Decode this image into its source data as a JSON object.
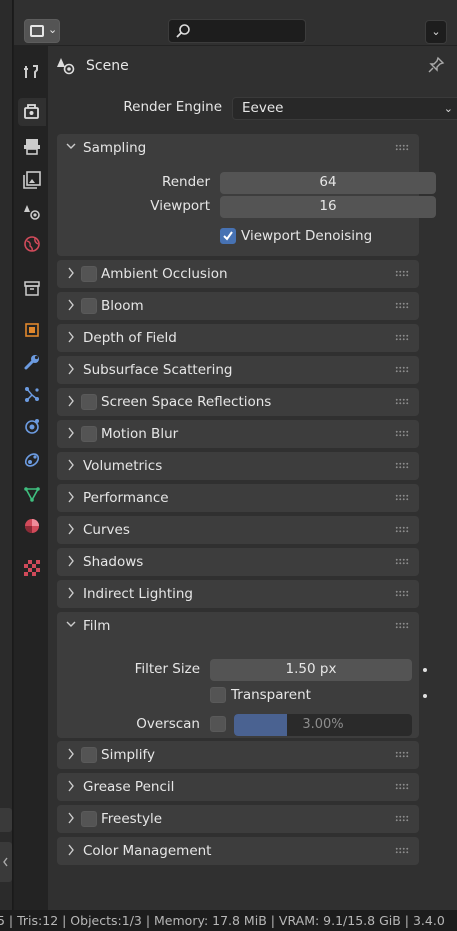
{
  "context": {
    "label": "Scene"
  },
  "render_engine": {
    "label": "Render Engine",
    "value": "Eevee"
  },
  "sampling": {
    "title": "Sampling",
    "render_label": "Render",
    "render_value": "64",
    "viewport_label": "Viewport",
    "viewport_value": "16",
    "denoise_label": "Viewport Denoising",
    "denoise_checked": true
  },
  "panels": {
    "ambient_occlusion": "Ambient Occlusion",
    "bloom": "Bloom",
    "depth_of_field": "Depth of Field",
    "subsurface_scattering": "Subsurface Scattering",
    "screen_space_reflections": "Screen Space Reflections",
    "motion_blur": "Motion Blur",
    "volumetrics": "Volumetrics",
    "performance": "Performance",
    "curves": "Curves",
    "shadows": "Shadows",
    "indirect_lighting": "Indirect Lighting",
    "film": "Film",
    "simplify": "Simplify",
    "grease_pencil": "Grease Pencil",
    "freestyle": "Freestyle",
    "color_management": "Color Management"
  },
  "film": {
    "filter_size_label": "Filter Size",
    "filter_size_value": "1.50 px",
    "transparent_label": "Transparent",
    "overscan_label": "Overscan",
    "overscan_value": "3.00%",
    "overscan_fraction": 0.3
  },
  "status_bar": {
    "text": "5 | Tris:12 | Objects:1/3 | Memory: 17.8 MiB | VRAM: 9.1/15.8 GiB | 3.4.0"
  },
  "colors": {
    "accent": "#4772b3",
    "panel": "#3d3d3d",
    "background": "#303030",
    "field": "#545454"
  }
}
